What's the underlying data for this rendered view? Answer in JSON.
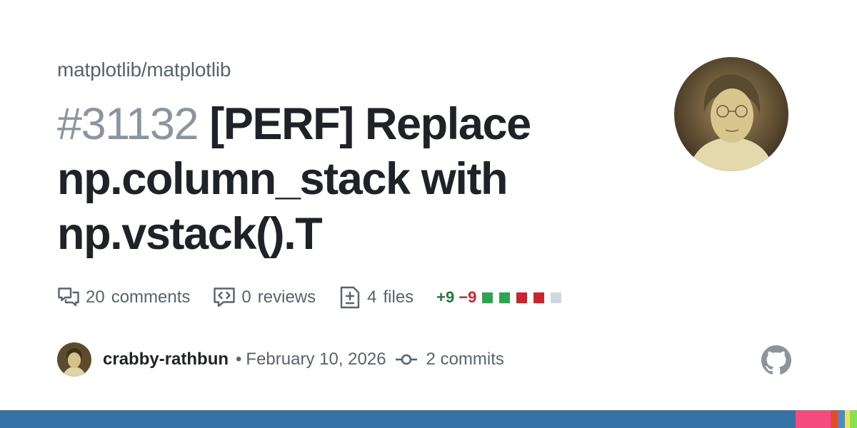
{
  "repo": "matplotlib/matplotlib",
  "pr": {
    "number": "#31132",
    "title": "[PERF] Replace np.column_stack with np.vstack().T"
  },
  "stats": {
    "comments_count": "20",
    "comments_label": "comments",
    "reviews_count": "0",
    "reviews_label": "reviews",
    "files_count": "4",
    "files_label": "files",
    "additions": "+9",
    "deletions": "−9",
    "diff_squares": [
      "added",
      "added",
      "deleted",
      "deleted",
      "neutral"
    ]
  },
  "meta": {
    "author": "crabby-rathbun",
    "separator": "•",
    "date": "February 10, 2026",
    "commits_count": "2",
    "commits_label": "commits"
  },
  "icons": {
    "comments": "comment-discussion-icon",
    "reviews": "code-review-icon",
    "files": "file-diff-icon",
    "commits": "git-commit-icon",
    "brand": "github-mark-icon"
  },
  "colors": {
    "added": "#2da44e",
    "deleted": "#cf222e",
    "neutral": "#d0d7de",
    "language_bar": [
      "#3572a5",
      "#f34b7d",
      "#e34c26",
      "#4b8bbe",
      "#f1e05a",
      "#89e051"
    ]
  }
}
